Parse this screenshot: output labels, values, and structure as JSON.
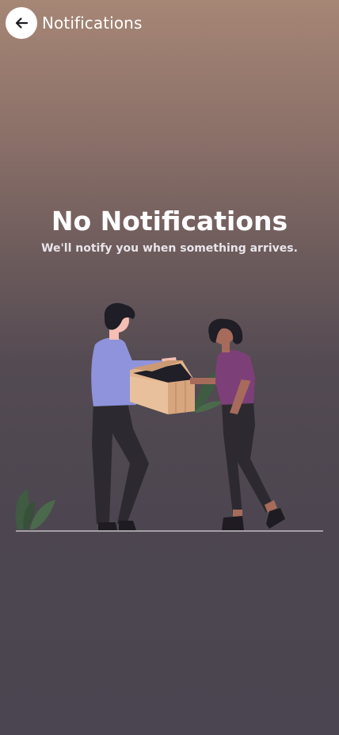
{
  "header": {
    "title": "Notifications",
    "back_icon": "arrow-left-icon"
  },
  "empty_state": {
    "title": "No Notifications",
    "subtitle": "We'll notify you when something arrives.",
    "illustration": "delivery-box-handoff"
  },
  "colors": {
    "background_top": "#a68675",
    "background_bottom": "#4a4550",
    "text": "#ffffff",
    "shirt_left": "#8e93dc",
    "shirt_right": "#7d3f78",
    "box": "#e2b48c",
    "plant": "#3f5b42"
  }
}
